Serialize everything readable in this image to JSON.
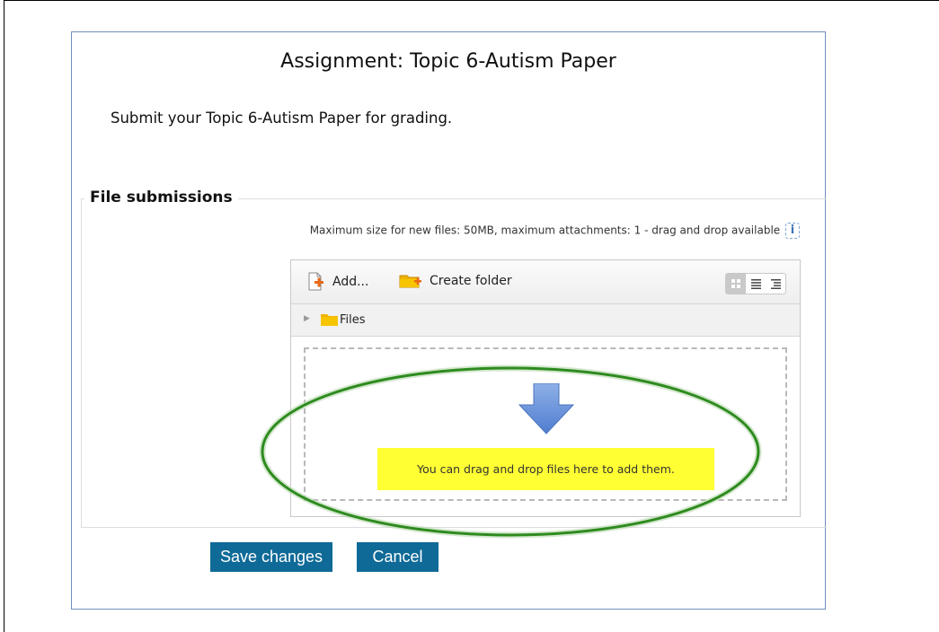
{
  "page": {
    "title": "Assignment: Topic 6-Autism Paper",
    "intro": "Submit your Topic 6-Autism Paper for grading."
  },
  "file_submissions": {
    "legend": "File submissions",
    "max_info": "Maximum size for new files: 50MB, maximum attachments: 1 - drag and drop available",
    "info_icon": "i"
  },
  "filemanager": {
    "toolbar": {
      "add_label": "Add...",
      "create_folder_label": "Create folder",
      "views": [
        "icons-view",
        "list-view",
        "tree-view"
      ]
    },
    "path": {
      "folder_label": "Files"
    },
    "dropzone": {
      "message": "You can drag and drop files here to add them."
    }
  },
  "buttons": {
    "save_label": "Save changes",
    "cancel_label": "Cancel"
  },
  "colors": {
    "accent_button": "#0f6a97",
    "highlight_oval": "#2e8b1f",
    "drop_message_bg": "#ffff33",
    "panel_border": "#6f8fc0"
  }
}
